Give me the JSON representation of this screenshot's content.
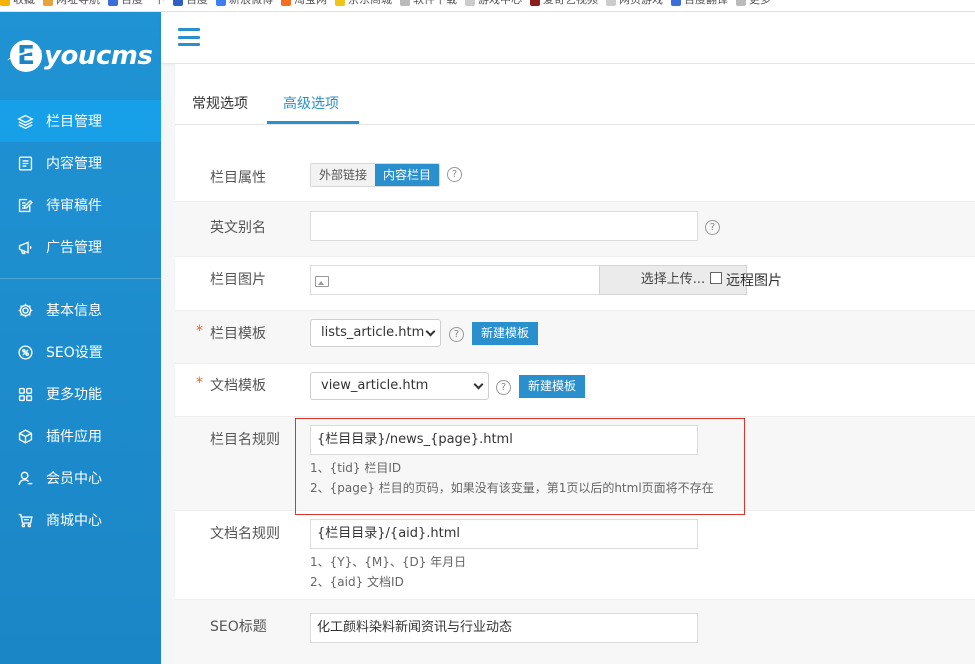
{
  "browser": {
    "bookmarks": [
      {
        "label": "收藏",
        "color": "#f4b400"
      },
      {
        "label": "网址导航",
        "color": "#e8a33c"
      },
      {
        "label": "百度一下",
        "color": "#3a6fd9"
      },
      {
        "label": "百度",
        "color": "#2f5ec4"
      },
      {
        "label": "新浪微博",
        "color": "#3d7ff0"
      },
      {
        "label": "淘宝网",
        "color": "#f26f21"
      },
      {
        "label": "京东商城",
        "color": "#f0c419"
      },
      {
        "label": "软件下载",
        "color": "#bbbbbb"
      },
      {
        "label": "游戏中心",
        "color": "#cccccc"
      },
      {
        "label": "爱奇艺视频",
        "color": "#8b1c1c"
      },
      {
        "label": "网页游戏",
        "color": "#cccccc"
      },
      {
        "label": "百度翻译",
        "color": "#3a6fd9"
      },
      {
        "label": "更多",
        "color": "#bbbbbb"
      }
    ]
  },
  "sidebar": {
    "logo_text": "youcms",
    "logo_mark": "E",
    "items": [
      {
        "label": "栏目管理",
        "icon": "layers-icon",
        "active": true
      },
      {
        "label": "内容管理",
        "icon": "document-icon"
      },
      {
        "label": "待审稿件",
        "icon": "edit-document-icon"
      },
      {
        "label": "广告管理",
        "icon": "megaphone-icon"
      },
      {
        "label": "基本信息",
        "icon": "gear-icon"
      },
      {
        "label": "SEO设置",
        "icon": "seo-icon"
      },
      {
        "label": "更多功能",
        "icon": "grid-icon"
      },
      {
        "label": "插件应用",
        "icon": "cube-icon"
      },
      {
        "label": "会员中心",
        "icon": "user-icon"
      },
      {
        "label": "商城中心",
        "icon": "cart-icon"
      }
    ]
  },
  "tabs": [
    "常规选项",
    "高级选项"
  ],
  "colors": {
    "sidebar": "#1b86c6",
    "sidebar_active": "#17a0e8",
    "accent": "#2a8fcd",
    "required": "#f0632c",
    "highlight_box": "#d9362b"
  },
  "form": {
    "attr": {
      "label": "栏目属性",
      "options": [
        "外部链接",
        "内容栏目"
      ],
      "selected": "内容栏目"
    },
    "alias": {
      "label": "英文别名",
      "value": ""
    },
    "image": {
      "label": "栏目图片",
      "upload_label": "选择上传...",
      "remote_label": "远程图片"
    },
    "list_tpl": {
      "label": "栏目模板",
      "required_mark": "*",
      "value": "lists_article.htm",
      "new_label": "新建模板"
    },
    "doc_tpl": {
      "label": "文档模板",
      "required_mark": "*",
      "value": "view_article.htm",
      "new_label": "新建模板"
    },
    "list_rule": {
      "label": "栏目名规则",
      "value": "{栏目目录}/news_{page}.html",
      "hints": [
        "1、{tid} 栏目ID",
        "2、{page} 栏目的页码，如果没有该变量，第1页以后的html页面将不存在"
      ]
    },
    "doc_rule": {
      "label": "文档名规则",
      "value": "{栏目目录}/{aid}.html",
      "hints": [
        "1、{Y}、{M}、{D} 年月日",
        "2、{aid} 文档ID"
      ]
    },
    "seo_title": {
      "label": "SEO标题",
      "value": "化工颜料染料新闻资讯与行业动态"
    },
    "help_glyph": "?"
  }
}
